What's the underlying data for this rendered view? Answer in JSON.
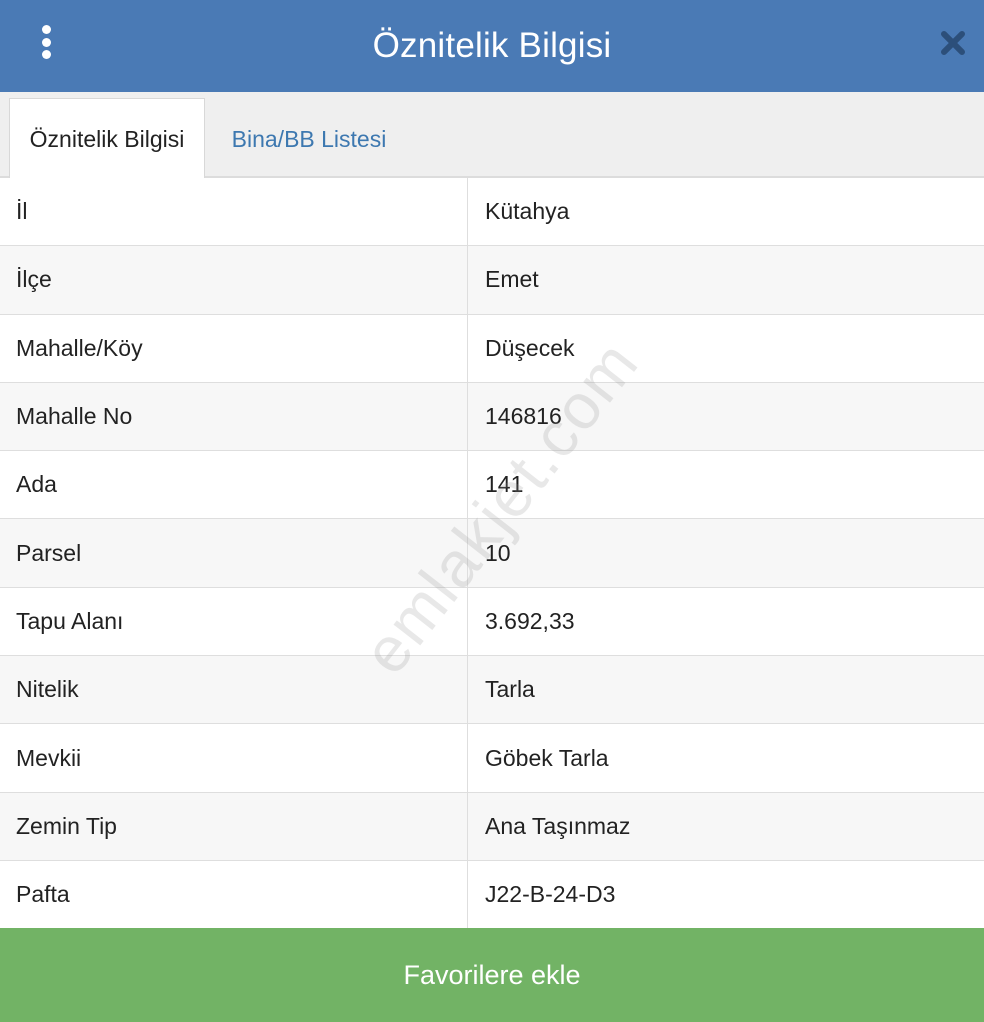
{
  "header": {
    "title": "Öznitelik Bilgisi",
    "menu_icon": "kebab-menu-icon",
    "close_icon": "close-icon",
    "background_color": "#4a7ab5"
  },
  "tabs": [
    {
      "label": "Öznitelik Bilgisi",
      "active": true
    },
    {
      "label": "Bina/BB Listesi",
      "active": false
    }
  ],
  "attributes": [
    {
      "key": "İl",
      "value": "Kütahya"
    },
    {
      "key": "İlçe",
      "value": "Emet"
    },
    {
      "key": "Mahalle/Köy",
      "value": "Düşecek"
    },
    {
      "key": "Mahalle No",
      "value": "146816"
    },
    {
      "key": "Ada",
      "value": "141"
    },
    {
      "key": "Parsel",
      "value": "10"
    },
    {
      "key": "Tapu Alanı",
      "value": "3.692,33"
    },
    {
      "key": "Nitelik",
      "value": "Tarla"
    },
    {
      "key": "Mevkii",
      "value": "Göbek Tarla"
    },
    {
      "key": "Zemin Tip",
      "value": "Ana Taşınmaz"
    },
    {
      "key": "Pafta",
      "value": "J22-B-24-D3"
    }
  ],
  "watermark": "emlakjet.com",
  "footer": {
    "favorite_label": "Favorilere ekle",
    "button_color": "#72b365"
  }
}
